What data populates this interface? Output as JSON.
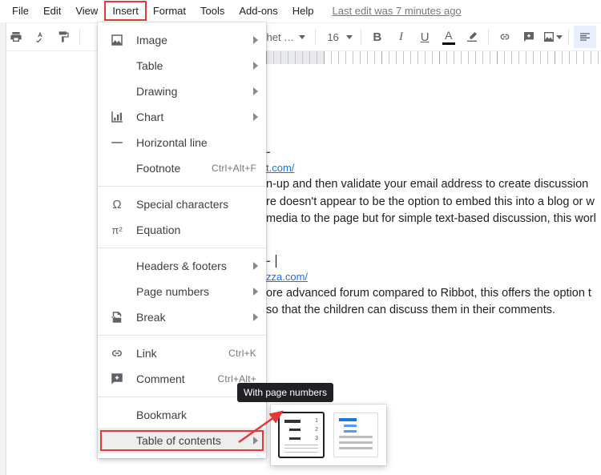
{
  "menubar": {
    "items": [
      "File",
      "Edit",
      "View",
      "Insert",
      "Format",
      "Tools",
      "Add-ons",
      "Help"
    ],
    "highlight_index": 3,
    "edit_info": "Last edit was 7 minutes ago"
  },
  "toolbar": {
    "font_name": "chet …",
    "font_size": "16"
  },
  "insert_menu": {
    "image": "Image",
    "table": "Table",
    "drawing": "Drawing",
    "chart": "Chart",
    "hline": "Horizontal line",
    "footnote": "Footnote",
    "footnote_sc": "Ctrl+Alt+F",
    "special": "Special characters",
    "equation": "Equation",
    "headers": "Headers & footers",
    "pagenums": "Page numbers",
    "break": "Break",
    "link": "Link",
    "link_sc": "Ctrl+K",
    "comment": "Comment",
    "comment_sc": "Ctrl+Alt+",
    "bookmark": "Bookmark",
    "toc": "Table of contents"
  },
  "submenu": {
    "tooltip": "With page numbers"
  },
  "document": {
    "dash1": "-",
    "link1": "t.com/",
    "p1a": "n-up and then validate your email address to create discussion",
    "p1b": "re doesn't appear to be the option to embed this into a blog or w",
    "p1c": "media to the page but for simple text-based discussion, this worl",
    "dash2": "-",
    "link2": "zza.com/",
    "p2a": "ore advanced forum compared to Ribbot, this offers the option t",
    "p2b": "so that the children can discuss them in their comments."
  }
}
